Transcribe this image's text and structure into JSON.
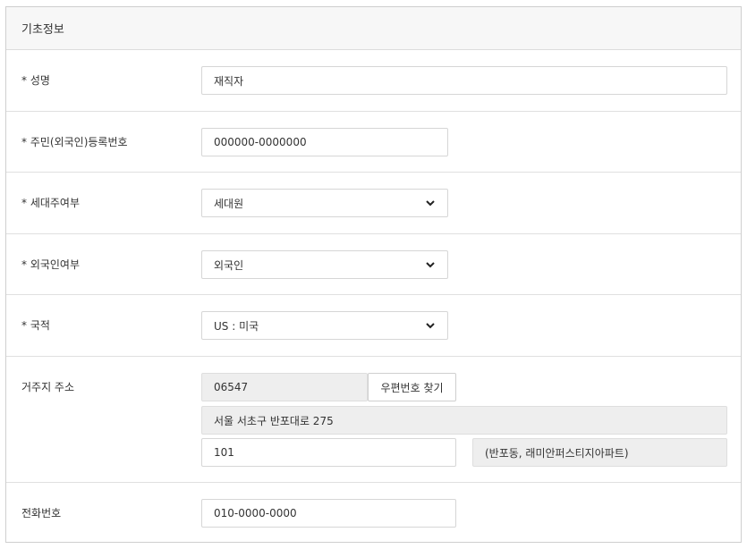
{
  "section": {
    "title": "기초정보"
  },
  "fields": {
    "name": {
      "label": "* 성명",
      "value": "재직자"
    },
    "rrn": {
      "label": "* 주민(외국인)등록번호",
      "value": "000000-0000000"
    },
    "householder": {
      "label": "* 세대주여부",
      "selected": "세대원"
    },
    "foreigner": {
      "label": "* 외국인여부",
      "selected": "외국인"
    },
    "nationality": {
      "label": "* 국적",
      "selected": "US : 미국"
    },
    "address": {
      "label": "거주지 주소",
      "zipcode": "06547",
      "find_zip_label": "우편번호 찾기",
      "road_address": "서울 서초구 반포대로 275",
      "detail": "101",
      "extra": "(반포동, 래미안퍼스티지아파트)"
    },
    "phone": {
      "label": "전화번호",
      "value": "010-0000-0000"
    }
  },
  "icons": {
    "select_arrow": "chevron-down-icon"
  }
}
